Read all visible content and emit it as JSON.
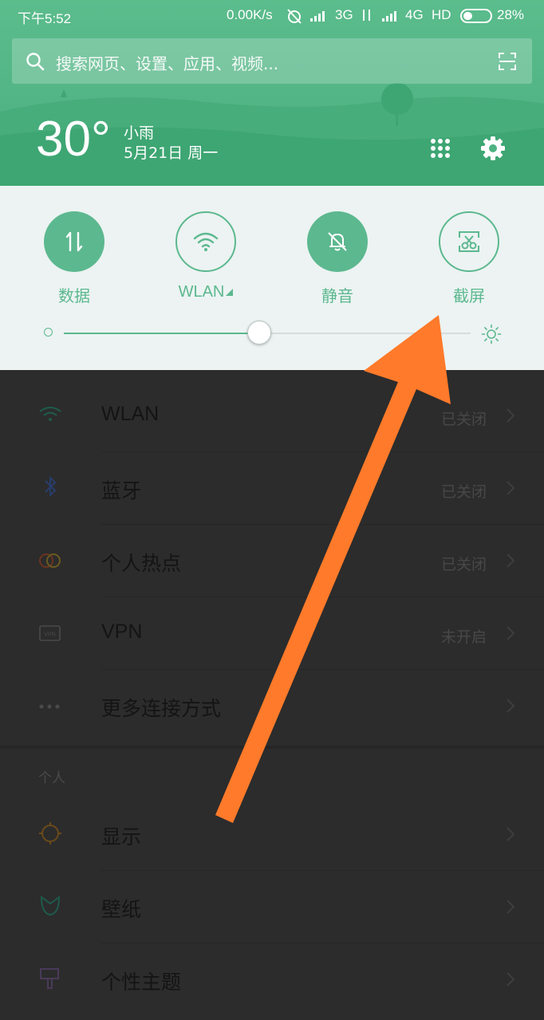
{
  "status_bar": {
    "time": "下午5:52",
    "net_speed": "0.00K/s",
    "network_3g": "3G",
    "network_4g": "4G",
    "hd": "HD",
    "battery": "28%"
  },
  "search": {
    "placeholder": "搜索网页、设置、应用、视频..."
  },
  "weather": {
    "temperature": "30°",
    "condition": "小雨",
    "date": "5月21日 周一"
  },
  "quick_toggles": [
    {
      "label": "数据",
      "icon": "data-icon",
      "active": true
    },
    {
      "label": "WLAN",
      "icon": "wifi-icon",
      "active": false
    },
    {
      "label": "静音",
      "icon": "silent-icon",
      "active": true
    },
    {
      "label": "截屏",
      "icon": "screenshot-icon",
      "active": false
    }
  ],
  "brightness": {
    "level": 0.48
  },
  "settings": {
    "rows": [
      {
        "title": "WLAN",
        "status": "已关闭",
        "icon": "wifi-icon"
      },
      {
        "title": "蓝牙",
        "status": "已关闭",
        "icon": "bluetooth-icon"
      },
      {
        "title": "个人热点",
        "status": "已关闭",
        "icon": "hotspot-icon"
      },
      {
        "title": "VPN",
        "status": "未开启",
        "icon": "vpn-icon"
      },
      {
        "title": "更多连接方式",
        "status": "",
        "icon": "more-icon"
      }
    ],
    "section_personal": "个人",
    "personal_rows": [
      {
        "title": "显示",
        "icon": "display-icon"
      },
      {
        "title": "壁纸",
        "icon": "wallpaper-icon"
      },
      {
        "title": "个性主题",
        "icon": "theme-icon"
      }
    ]
  },
  "colors": {
    "header_green": "#52b585",
    "accent": "#5cb88f",
    "panel_bg": "#ecf3f2",
    "arrow": "#ff7a2a"
  }
}
